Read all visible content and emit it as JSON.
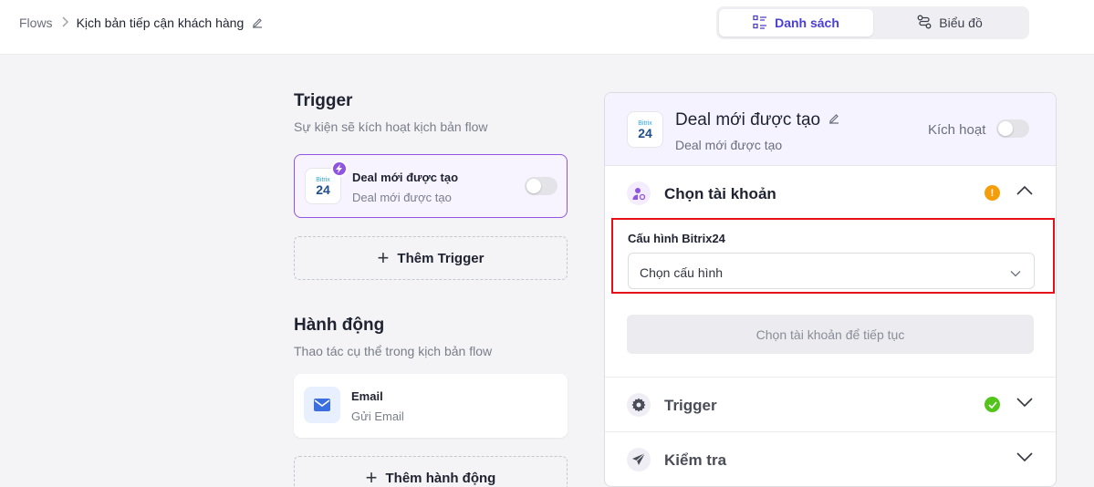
{
  "breadcrumb": {
    "root": "Flows",
    "current": "Kịch bản tiếp cận khách hàng"
  },
  "view_toggle": {
    "list_label": "Danh sách",
    "chart_label": "Biểu đồ",
    "active": "Danh sách"
  },
  "trigger_section": {
    "title": "Trigger",
    "subtitle": "Sự kiện sẽ kích hoạt kịch bản flow",
    "card": {
      "logo_small": "Bitrix",
      "logo_big": "24",
      "title": "Deal mới được tạo",
      "subtitle": "Deal mới được tạo",
      "enabled": false
    },
    "add_label": "Thêm Trigger"
  },
  "action_section": {
    "title": "Hành động",
    "subtitle": "Thao tác cụ thể trong kịch bản flow",
    "card": {
      "title": "Email",
      "subtitle": "Gửi Email"
    },
    "add_label": "Thêm hành động"
  },
  "panel": {
    "logo_small": "Bitrix",
    "logo_big": "24",
    "title": "Deal mới được tạo",
    "subtitle": "Deal mới được tạo",
    "active_label": "Kích hoạt",
    "active": false,
    "account_section": {
      "label": "Chọn tài khoản",
      "status": "warning",
      "expanded": true,
      "config_label": "Cấu hình Bitrix24",
      "select_placeholder": "Chọn cấu hình",
      "continue_label": "Chọn tài khoản để tiếp tục"
    },
    "trigger_row": {
      "label": "Trigger",
      "status": "done"
    },
    "check_row": {
      "label": "Kiểm tra"
    }
  },
  "colors": {
    "accent": "#4a3fd0",
    "purple": "#8f55e0",
    "warning": "#f59e0b",
    "success": "#52c41a",
    "highlight": "#e3101a"
  }
}
